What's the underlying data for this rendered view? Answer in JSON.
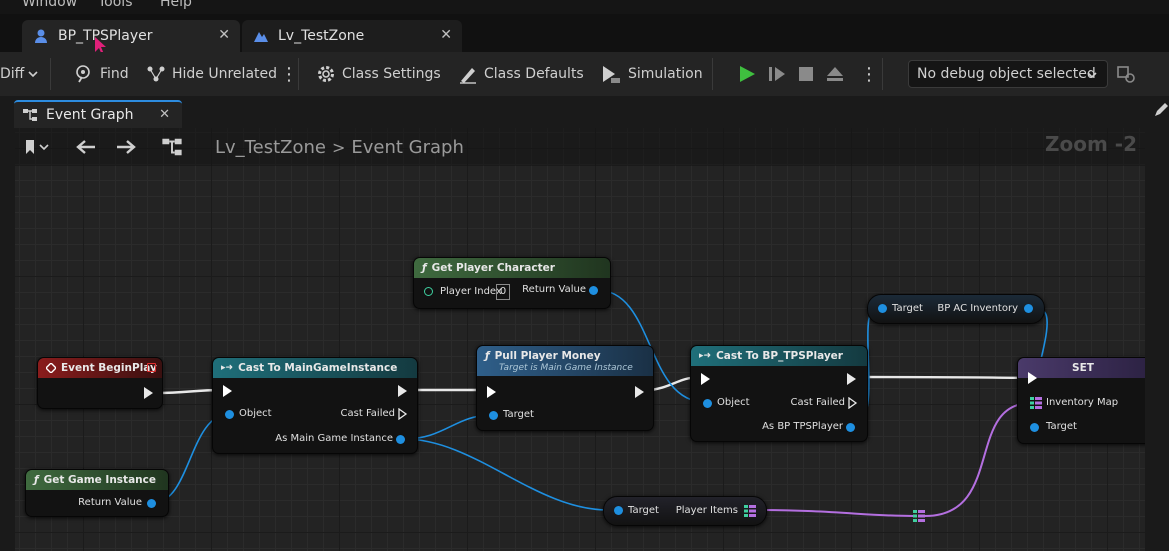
{
  "menu": {
    "window": "Window",
    "tools": "Tools",
    "help": "Help"
  },
  "doc_tabs": [
    {
      "label": "BP_TPSPlayer"
    },
    {
      "label": "Lv_TestZone"
    }
  ],
  "toolbar": {
    "diff": "Diff",
    "find": "Find",
    "hide_unrelated": "Hide Unrelated",
    "class_settings": "Class Settings",
    "class_defaults": "Class Defaults",
    "simulation": "Simulation",
    "debug_object": "No debug object selected"
  },
  "graph_tab": {
    "label": "Event Graph"
  },
  "breadcrumb": {
    "root": "Lv_TestZone",
    "separator": ">",
    "current": "Event Graph"
  },
  "zoom": "Zoom -2",
  "nodes": {
    "event_begin_play": {
      "title": "Event BeginPlay"
    },
    "get_game_instance": {
      "title": "Get Game Instance",
      "return_value": "Return Value"
    },
    "cast_main": {
      "title": "Cast To MainGameInstance",
      "object": "Object",
      "cast_failed": "Cast Failed",
      "as_main": "As Main Game Instance"
    },
    "get_player_character": {
      "title": "Get Player Character",
      "player_index": "Player Index",
      "player_index_value": "0",
      "return_value": "Return Value"
    },
    "pull_money": {
      "title": "Pull Player Money",
      "subtitle": "Target is Main Game Instance",
      "target": "Target"
    },
    "cast_tps": {
      "title": "Cast To BP_TPSPlayer",
      "object": "Object",
      "cast_failed": "Cast Failed",
      "as_bp": "As BP TPSPlayer"
    },
    "bp_inventory": {
      "target": "Target",
      "value": "BP AC Inventory"
    },
    "player_items": {
      "target": "Target",
      "value": "Player Items"
    },
    "set": {
      "title": "SET",
      "inventory_map": "Inventory Map",
      "target": "Target"
    }
  },
  "colors": {
    "accent": "#2d8ce0",
    "object_pin": "#1e8fe0",
    "map_pin": "#b46fe0",
    "event_head": "#8a1c1c",
    "cast_head": "#1f6f7a",
    "func_head": "#3f6a3f"
  }
}
